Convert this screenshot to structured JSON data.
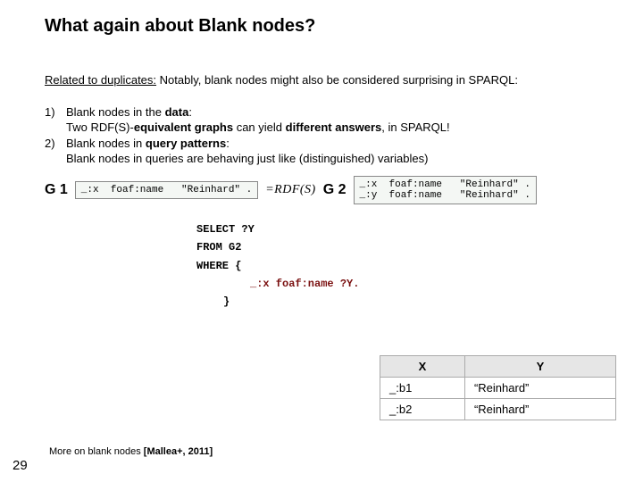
{
  "title": "What again about Blank nodes?",
  "intro": {
    "lead": "Related to duplicates:",
    "rest": " Notably, blank nodes might also be considered surprising in SPARQL:"
  },
  "bullets": {
    "b1_num": "1)",
    "b1_a": "Blank nodes in the ",
    "b1_b": "data",
    "b1_c": ":",
    "b1_sub_a": "Two RDF(S)-",
    "b1_sub_b": "equivalent graphs",
    "b1_sub_c": " can yield ",
    "b1_sub_d": "different answers",
    "b1_sub_e": ", in SPARQL!",
    "b2_num": "2)",
    "b2_a": "Blank nodes in ",
    "b2_b": "query patterns",
    "b2_c": ":",
    "b2_sub": "Blank nodes in queries are behaving just like (distinguished) variables)"
  },
  "graphs": {
    "g1_label": "G 1",
    "g1_code": "_:x  foaf:name   \"Reinhard\" .",
    "eq": "=RDF(S)",
    "g2_label": "G 2",
    "g2_code": "_:x  foaf:name   \"Reinhard\" .\n_:y  foaf:name   \"Reinhard\" ."
  },
  "query": {
    "select": "SELECT ?Y",
    "from": "FROM G2",
    "where_open": "WHERE {",
    "where_inner": "_:x foaf:name ?Y.",
    "brace": "}"
  },
  "table": {
    "h1": "X",
    "h2": "Y",
    "r1c1": "_:b1",
    "r1c2": "“Reinhard”",
    "r2c1": "_:b2",
    "r2c2": "“Reinhard”"
  },
  "citation": {
    "pre": "More on blank nodes ",
    "ref": "[Mallea+, 2011]"
  },
  "pagenum": "29"
}
